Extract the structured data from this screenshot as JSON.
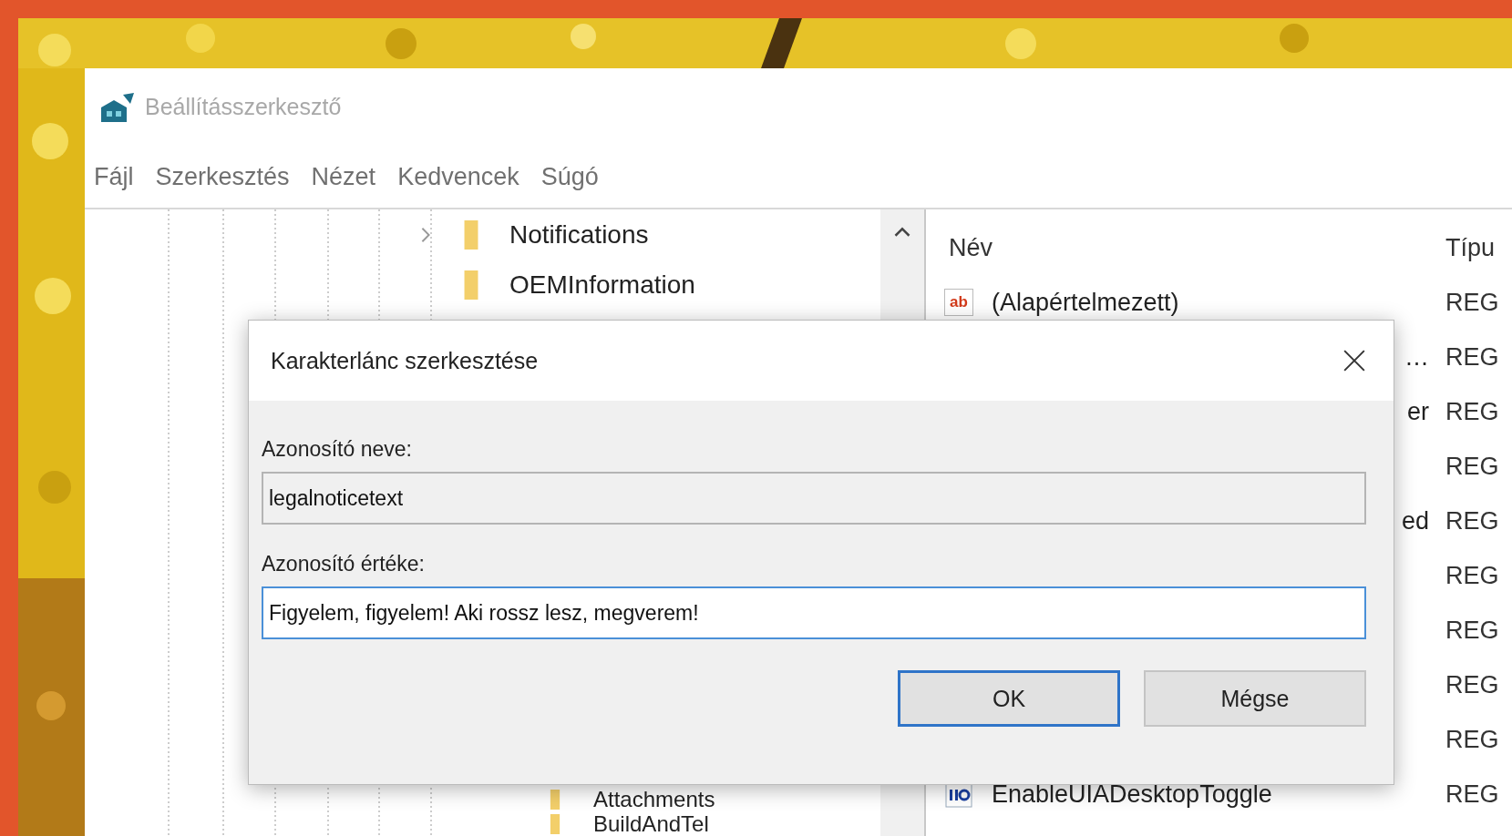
{
  "window": {
    "title": "Beállításszerkesztő"
  },
  "menu": [
    {
      "label": "Fájl"
    },
    {
      "label": "Szerkesztés"
    },
    {
      "label": "Nézet"
    },
    {
      "label": "Kedvencek"
    },
    {
      "label": "Súgó"
    }
  ],
  "tree": {
    "top_items": [
      {
        "label": "Notifications",
        "expandable": true
      },
      {
        "label": "OEMInformation",
        "expandable": false
      }
    ],
    "bottom_items": [
      {
        "label": "Attachments",
        "expandable": false
      },
      {
        "label": "BuildAndTel",
        "expandable": false
      }
    ]
  },
  "values": {
    "columns": [
      "Név",
      "Típu"
    ],
    "rows": [
      {
        "kind": "string",
        "icon_text": "ab",
        "name": "(Alapértelmezett)",
        "type": "REG"
      },
      {
        "name": "…",
        "type": "REG"
      },
      {
        "name": "er",
        "type": "REG"
      },
      {
        "type": "REG"
      },
      {
        "name": "ed",
        "type": "REG"
      },
      {
        "type": "REG"
      },
      {
        "type": "REG"
      },
      {
        "type": "REG"
      },
      {
        "type": "REG"
      },
      {
        "kind": "binary",
        "name": "EnableUIADesktopToggle",
        "type": "REG"
      }
    ]
  },
  "dialog": {
    "title": "Karakterlánc szerkesztése",
    "name_label": "Azonosító neve:",
    "name_value": "legalnoticetext",
    "value_label": "Azonosító értéke:",
    "value": "Figyelem, figyelem! Aki rossz lesz, megverem!",
    "buttons": [
      {
        "label": "OK",
        "default": true
      },
      {
        "label": "Mégse",
        "default": false
      }
    ]
  }
}
